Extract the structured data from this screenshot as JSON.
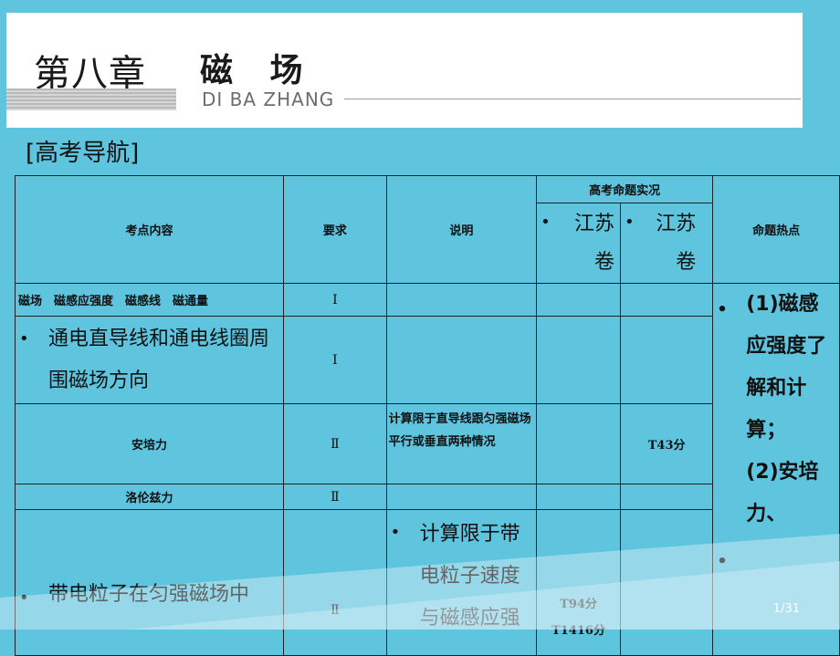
{
  "header": {
    "chapter_label": "第八章",
    "chapter_topic": "磁 场",
    "pinyin": "DI BA ZHANG"
  },
  "section_title": "[高考导航]",
  "table": {
    "headers": {
      "content": "考点内容",
      "requirement": "要求",
      "explanation": "说明",
      "group": "高考命题实况",
      "js1": "江苏卷",
      "js2": "江苏卷",
      "hot": "命题热点"
    },
    "rows": [
      {
        "content": "磁场　磁感应强度　磁感线　磁通量",
        "req": "Ⅰ",
        "note": "",
        "c1": "",
        "c2": ""
      },
      {
        "content": "通电直导线和通电线圈周围磁场方向",
        "req": "Ⅰ",
        "note": "",
        "c1": "",
        "c2": ""
      },
      {
        "content": "安培力",
        "req": "Ⅱ",
        "note": "计算限于直导线跟匀强磁场平行或垂直两种情况",
        "c1": "",
        "c2": "T43分"
      },
      {
        "content": "洛伦兹力",
        "req": "Ⅱ",
        "note": "",
        "c1": "",
        "c2": ""
      },
      {
        "content": "带电粒子在匀强磁场中",
        "req": "Ⅱ",
        "note": "计算限于带电粒子速度与磁感应强",
        "c1": "T94分",
        "c2": "T1416分"
      }
    ],
    "hot_items": [
      "(1)磁感应强度了解和计算；",
      "(2)安培力、"
    ]
  },
  "page_number": "1/31"
}
